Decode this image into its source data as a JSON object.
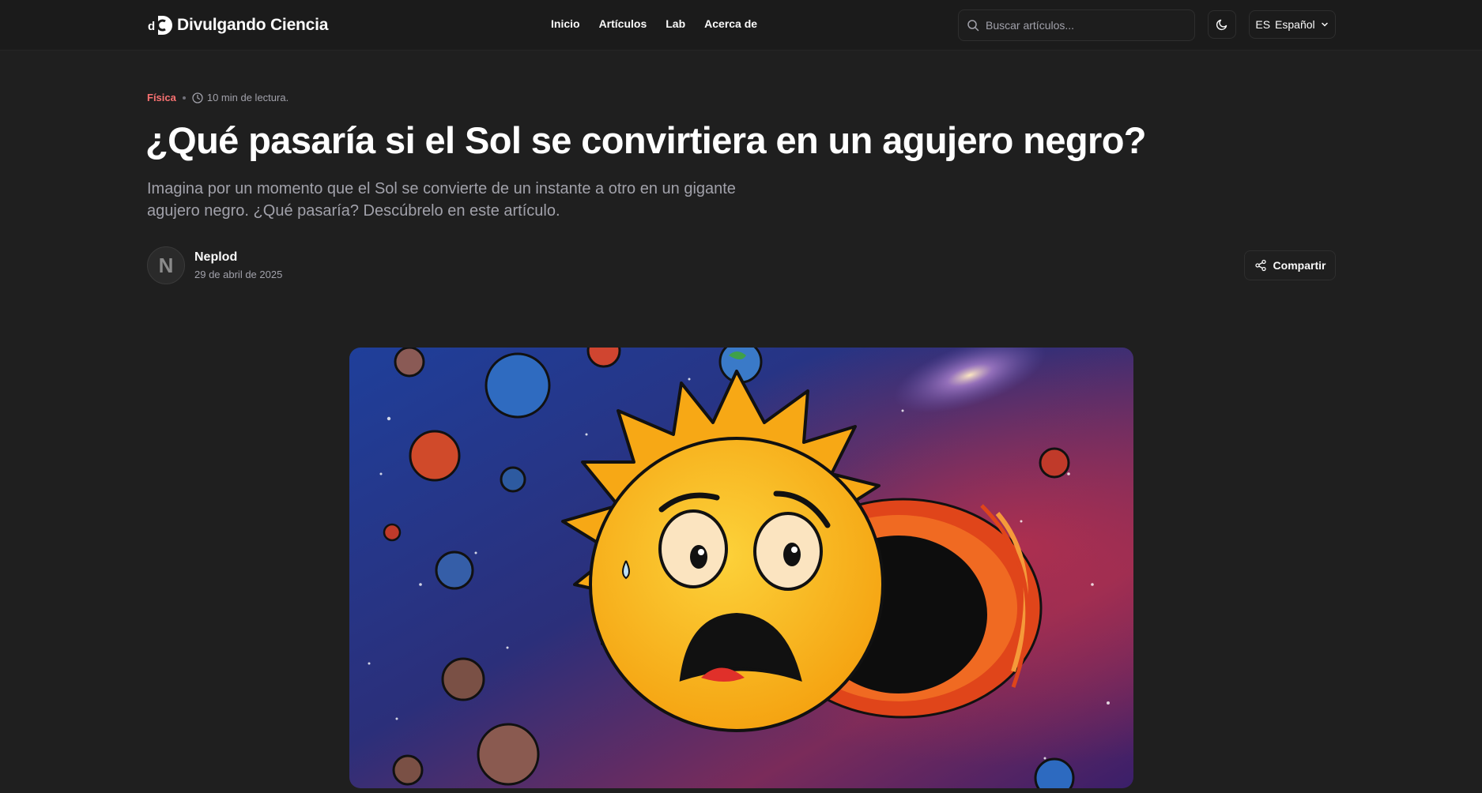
{
  "header": {
    "brand": "Divulgando Ciencia",
    "logo_initials": "dC",
    "nav": [
      "Inicio",
      "Artículos",
      "Lab",
      "Acerca de"
    ],
    "search_placeholder": "Buscar artículos...",
    "theme_icon": "moon-icon",
    "language": {
      "code": "ES",
      "name": "Español"
    }
  },
  "article": {
    "category": "Física",
    "read_time": "10 min de lectura.",
    "title": "¿Qué pasaría si el Sol se convirtiera en un agujero negro?",
    "subtitle": "Imagina por un momento que el Sol se convierte de un instante a otro en un gigante agujero negro. ¿Qué pasaría? Descúbrelo en este artículo.",
    "author": {
      "name": "Neplod",
      "date": "29 de abril de 2025",
      "avatar_initial": "N"
    },
    "share_label": "Compartir"
  },
  "colors": {
    "background": "#1f1f1f",
    "header": "#1b1b1b",
    "category": "#f87171",
    "muted": "#a1a1aa"
  }
}
